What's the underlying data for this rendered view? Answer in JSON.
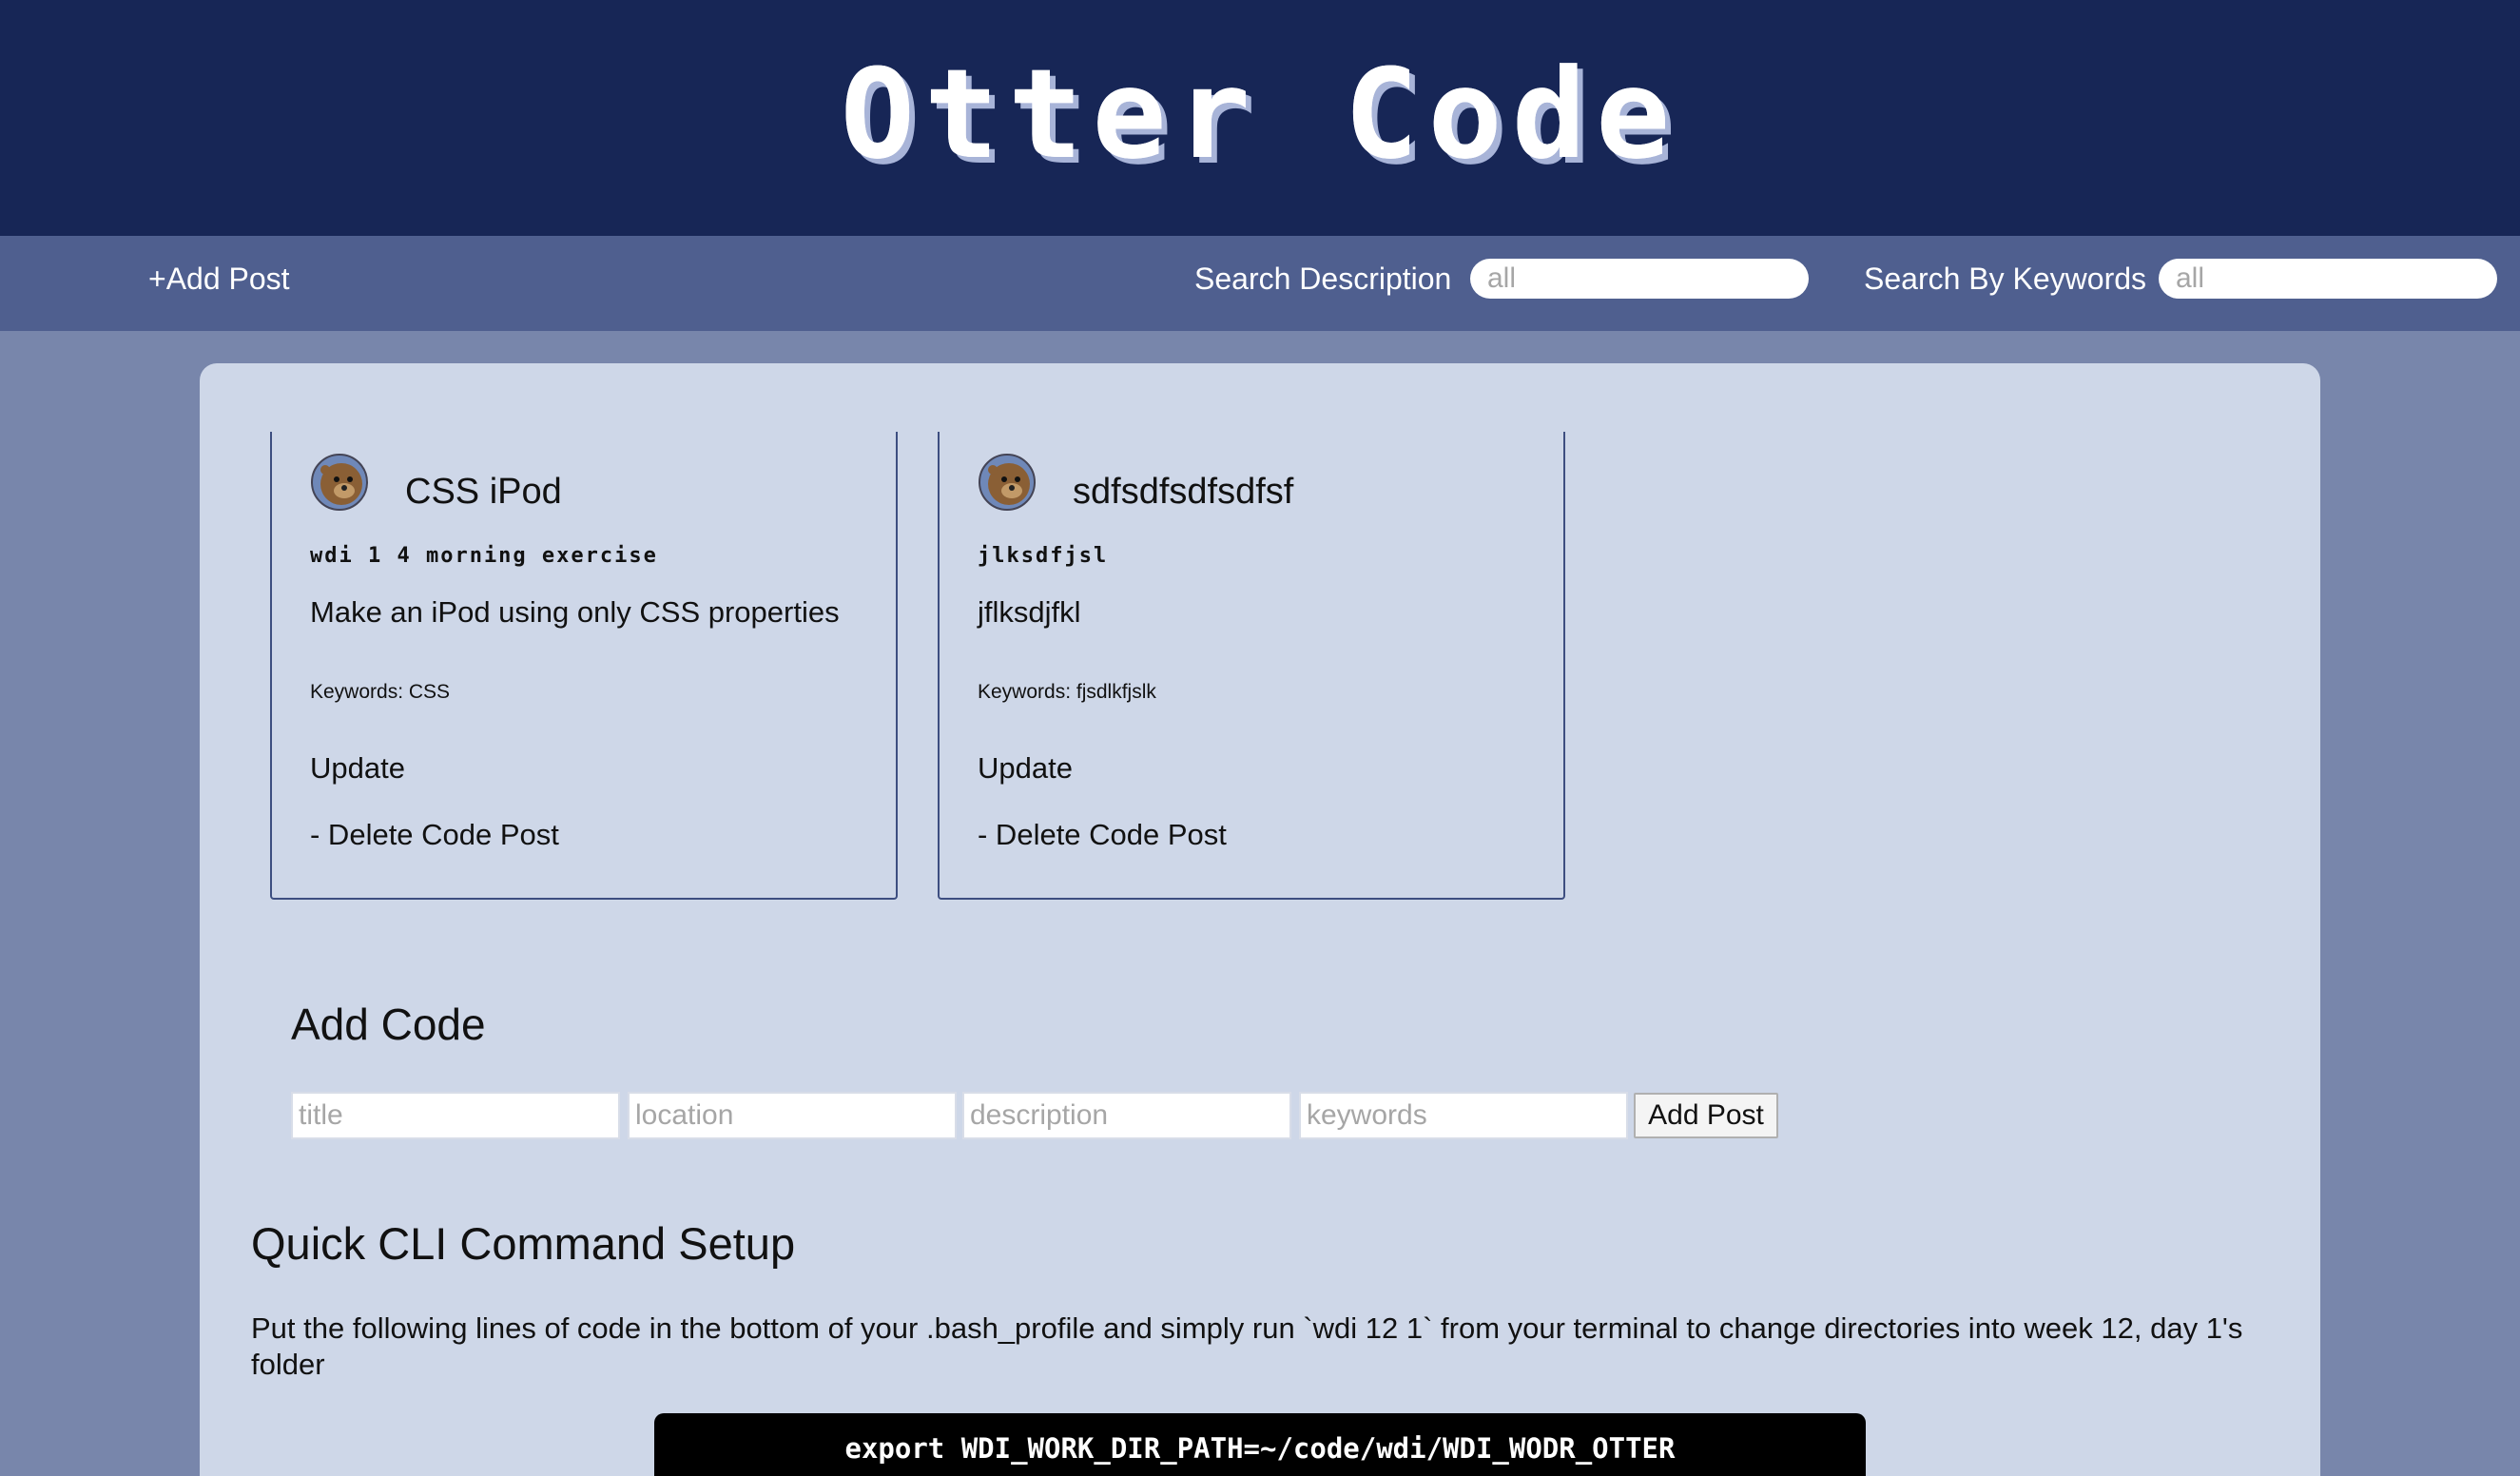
{
  "header": {
    "title": "Otter Code"
  },
  "nav": {
    "add_post": "+Add Post",
    "search_description_label": "Search Description",
    "search_description_placeholder": "all",
    "search_keywords_label": "Search By Keywords",
    "search_keywords_placeholder": "all"
  },
  "posts": [
    {
      "title": "CSS iPod",
      "location": "wdi 1 4 morning exercise",
      "description": "Make an iPod using only CSS properties",
      "keywords": "Keywords: CSS",
      "update": "Update",
      "delete": "- Delete Code Post"
    },
    {
      "title": "sdfsdfsdfsdfsf",
      "location": "jlksdfjsl",
      "description": "jflksdjfkl",
      "keywords": "Keywords: fjsdlkfjslk",
      "update": "Update",
      "delete": "- Delete Code Post"
    }
  ],
  "add_code": {
    "heading": "Add Code",
    "title_placeholder": "title",
    "location_placeholder": "location",
    "description_placeholder": "description",
    "keywords_placeholder": "keywords",
    "submit_label": "Add Post"
  },
  "cli": {
    "heading": "Quick CLI Command Setup",
    "text": "Put the following lines of code in the bottom of your .bash_profile and simply run `wdi 12 1` from your terminal to change directories into week 12, day 1's folder",
    "code": "export WDI_WORK_DIR_PATH=~/code/wdi/WDI_WODR_OTTER"
  },
  "colors": {
    "header_bg": "#172656",
    "nav_bg": "#4f5f8f",
    "page_bg": "#7886ab",
    "panel_bg": "#ced7e8"
  },
  "icons": {
    "avatar": "otter-avatar-icon"
  }
}
